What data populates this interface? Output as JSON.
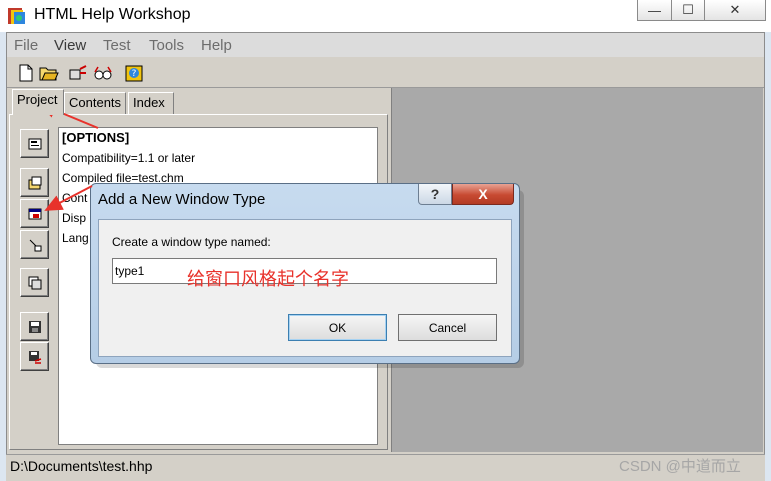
{
  "window": {
    "title": "HTML Help Workshop",
    "controls": {
      "minimize": "—",
      "maximize": "☐",
      "close": "✕"
    }
  },
  "menu": [
    "File",
    "View",
    "Test",
    "Tools",
    "Help"
  ],
  "tabs": [
    "Project",
    "Contents",
    "Index"
  ],
  "editor": {
    "lines": [
      "[OPTIONS]",
      "Compatibility=1.1 or later",
      "Compiled file=test.chm",
      "Cont",
      "Disp",
      "Lang"
    ]
  },
  "dialog": {
    "title": "Add a New Window Type",
    "label": "Create a window type named:",
    "input_value": "type1",
    "ok": "OK",
    "cancel": "Cancel",
    "help_glyph": "?",
    "close_glyph": "X"
  },
  "annotation": "给窗口风格起个名字",
  "status": "D:\\Documents\\test.hhp",
  "watermark": "CSDN @中道而立",
  "colors": {
    "annotation_red": "#e8322b",
    "workspace_gray": "#a9a9a9"
  }
}
